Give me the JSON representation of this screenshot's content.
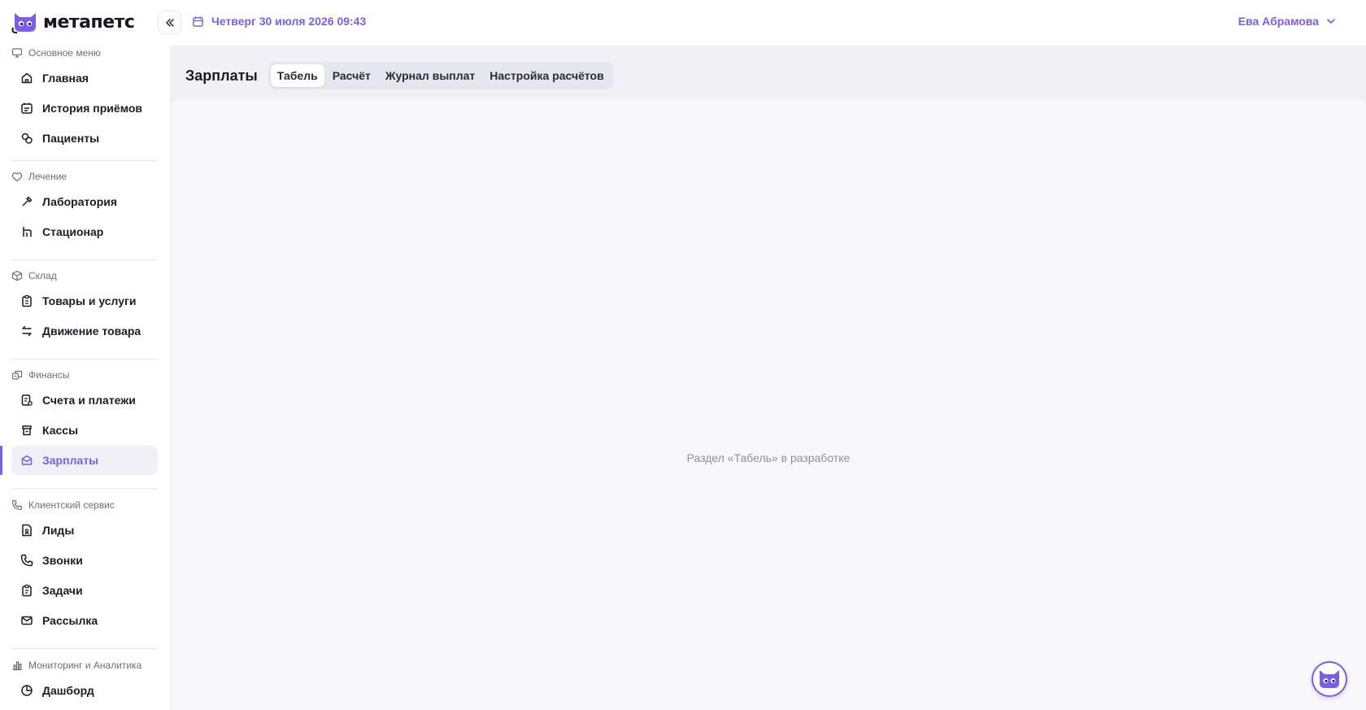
{
  "app": {
    "brand_name": "метапетс",
    "date_text": "Четверг 30 июля 2026 09:43",
    "user_name": "Ева Абрамова"
  },
  "sidebar": {
    "sections": [
      {
        "title": "Основное меню",
        "icon": "monitor-icon",
        "items": [
          {
            "label": "Главная",
            "icon": "home-icon"
          },
          {
            "label": "История приёмов",
            "icon": "calendar-list-icon"
          },
          {
            "label": "Пациенты",
            "icon": "patients-icon"
          }
        ]
      },
      {
        "title": "Лечение",
        "icon": "heart-shield-icon",
        "items": [
          {
            "label": "Лаборатория",
            "icon": "pipette-icon"
          },
          {
            "label": "Стационар",
            "icon": "bed-icon"
          }
        ]
      },
      {
        "title": "Склад",
        "icon": "box-icon",
        "items": [
          {
            "label": "Товары и услуги",
            "icon": "clipboard-icon"
          },
          {
            "label": "Движение товара",
            "icon": "arrows-swap-icon"
          }
        ]
      },
      {
        "title": "Финансы",
        "icon": "coins-icon",
        "items": [
          {
            "label": "Счета и платежи",
            "icon": "invoice-icon"
          },
          {
            "label": "Кассы",
            "icon": "cash-register-icon"
          },
          {
            "label": "Зарплаты",
            "icon": "salary-icon",
            "active": true
          }
        ]
      },
      {
        "title": "Клиентский сервис",
        "icon": "phone-icon",
        "items": [
          {
            "label": "Лиды",
            "icon": "lead-doc-icon"
          },
          {
            "label": "Звонки",
            "icon": "phone-icon"
          },
          {
            "label": "Задачи",
            "icon": "tasks-icon"
          },
          {
            "label": "Рассылка",
            "icon": "mail-icon"
          }
        ]
      },
      {
        "title": "Мониторинг и Аналитика",
        "icon": "bar-chart-icon",
        "items": [
          {
            "label": "Дашборд",
            "icon": "pie-chart-icon"
          }
        ]
      }
    ]
  },
  "main": {
    "title": "Зарплаты",
    "tabs": [
      {
        "label": "Табель",
        "active": true
      },
      {
        "label": "Расчёт"
      },
      {
        "label": "Журнал выплат"
      },
      {
        "label": "Настройка расчётов"
      }
    ],
    "empty_message": "Раздел «Табель» в разработке"
  },
  "colors": {
    "accent": "#7c5cf0",
    "text": "#1c1c28",
    "muted": "#8c8fa3",
    "main_bg": "#f1f1f5"
  }
}
